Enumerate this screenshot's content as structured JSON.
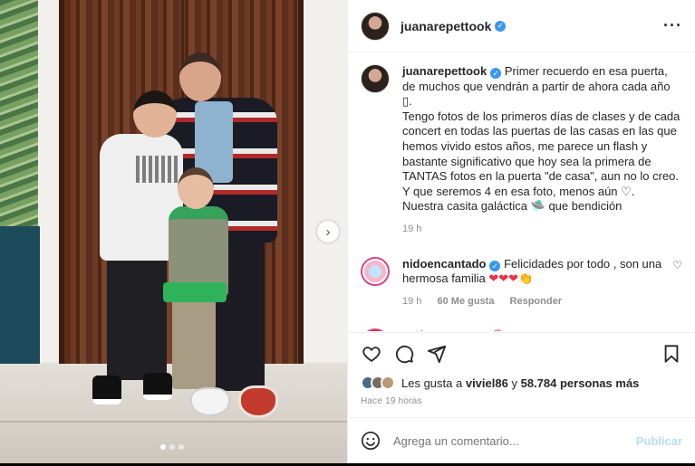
{
  "post": {
    "username": "juanarepettook",
    "verified_icon": "verified-badge-icon",
    "more_icon": "more-options-icon"
  },
  "caption": {
    "username": "juanarepettook",
    "text_1": "Primer recuerdo en esa puerta, de muchos que vendrán a partir de ahora cada año",
    "text_1_emoji": "▯.",
    "text_2": "Tengo fotos de los primeros días de clases y de cada concert en todas las puertas de las casas en las que hemos vivido estos años, me parece un flash y bastante significativo que hoy sea la primera de TANTAS fotos en la puerta \"de casa\", aun no lo creo. Y que seremos 4 en esa foto, menos aún",
    "text_2_emoji": "♡.",
    "text_3": "Nuestra casita galáctica",
    "text_3_emoji": "🛸",
    "text_3_end": "que bendición",
    "time": "19 h"
  },
  "comments": [
    {
      "username": "nidoencantado",
      "text": "Felicidades por todo , son una hermosa familia",
      "emojis": "❤❤❤👏",
      "time": "19 h",
      "likes": "60 Me gusta",
      "reply": "Responder"
    },
    {
      "username": "serbazares",
      "text": "",
      "emojis": "❤😊"
    }
  ],
  "carousel": {
    "next_icon": "›",
    "active_index": 0,
    "count": 3
  },
  "likes": {
    "prefix": "Les gusta a",
    "user": "viviel86",
    "connector": "y",
    "count": "58.784 personas más"
  },
  "timestamp": "Hace 19 horas",
  "add_comment": {
    "placeholder": "Agrega un comentario...",
    "post_label": "Publicar"
  },
  "colors": {
    "verified": "#3897f0",
    "heart": "#ed2f46",
    "publish_disabled": "#b2dffc",
    "muted": "#8e8e8e"
  }
}
